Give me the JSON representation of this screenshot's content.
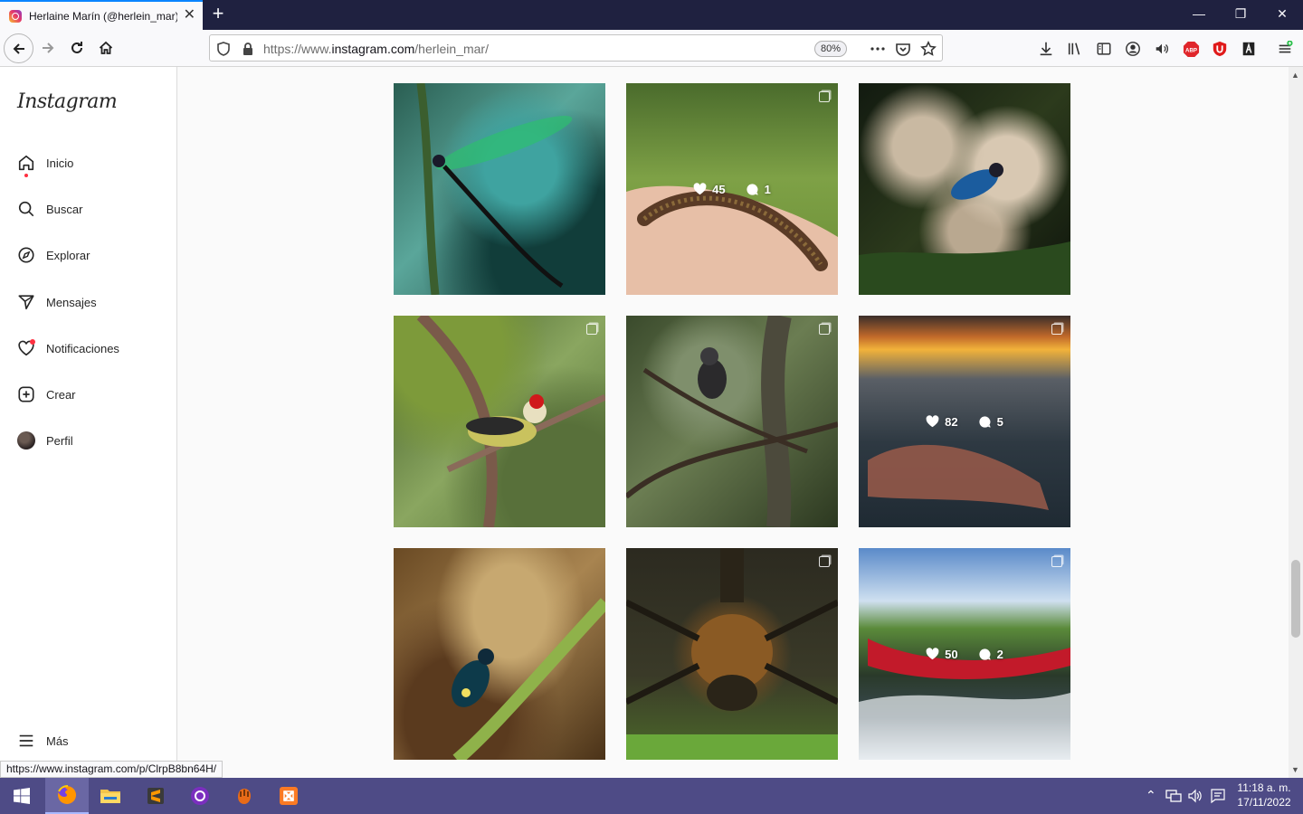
{
  "browser": {
    "tab_title": "Herlaine Marín (@herlein_mar)",
    "tab_close": "✕",
    "new_tab": "+",
    "url_prefix": "https://www.",
    "url_domain": "instagram.com",
    "url_path": "/herlein_mar/",
    "zoom": "80%",
    "status_url": "https://www.instagram.com/p/ClrpB8bn64H/"
  },
  "instagram": {
    "logo": "Instagram",
    "nav": [
      {
        "label": "Inicio",
        "icon": "home-icon"
      },
      {
        "label": "Buscar",
        "icon": "search-icon"
      },
      {
        "label": "Explorar",
        "icon": "compass-icon"
      },
      {
        "label": "Mensajes",
        "icon": "send-icon"
      },
      {
        "label": "Notificaciones",
        "icon": "heart-icon"
      },
      {
        "label": "Crear",
        "icon": "plus-square-icon"
      },
      {
        "label": "Perfil",
        "icon": "avatar"
      }
    ],
    "more": "Más"
  },
  "posts": [
    {
      "subject": "dragonfly",
      "multi": false,
      "likes": "",
      "comments": ""
    },
    {
      "subject": "lizard-on-hand",
      "multi": true,
      "likes": "45",
      "comments": "1"
    },
    {
      "subject": "blue-bird-flowers",
      "multi": false,
      "likes": "",
      "comments": ""
    },
    {
      "subject": "red-crowned-bird",
      "multi": true,
      "likes": "",
      "comments": ""
    },
    {
      "subject": "monkey-in-tree",
      "multi": true,
      "likes": "",
      "comments": ""
    },
    {
      "subject": "sunset-beach",
      "multi": true,
      "likes": "82",
      "comments": "5"
    },
    {
      "subject": "blue-beetle",
      "multi": false,
      "likes": "",
      "comments": ""
    },
    {
      "subject": "whip-spider",
      "multi": true,
      "likes": "",
      "comments": ""
    },
    {
      "subject": "river-hammock",
      "multi": true,
      "likes": "50",
      "comments": "2"
    }
  ],
  "taskbar": {
    "time": "11:18 a. m.",
    "date": "17/11/2022"
  },
  "colors": {
    "titlebar": "#1f2140",
    "taskbar": "#4e4b86",
    "accent": "#0a84ff",
    "notification": "#ff3040"
  }
}
